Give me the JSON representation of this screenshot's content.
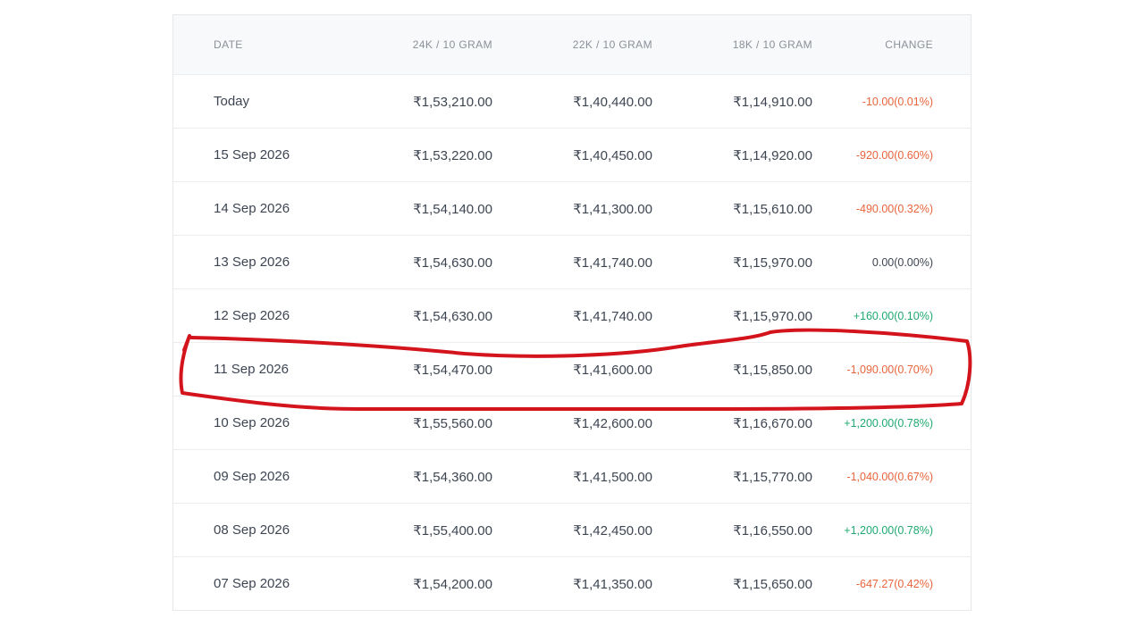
{
  "table": {
    "headers": {
      "date": "DATE",
      "k24": "24K / 10 GRAM",
      "k22": "22K / 10 GRAM",
      "k18": "18K / 10 GRAM",
      "change": "CHANGE"
    },
    "rows": [
      {
        "date": "Today",
        "k24": "₹1,53,210.00",
        "k22": "₹1,40,440.00",
        "k18": "₹1,14,910.00",
        "change": "-10.00(0.01%)",
        "trend": "neg"
      },
      {
        "date": "15 Sep 2026",
        "k24": "₹1,53,220.00",
        "k22": "₹1,40,450.00",
        "k18": "₹1,14,920.00",
        "change": "-920.00(0.60%)",
        "trend": "neg"
      },
      {
        "date": "14 Sep 2026",
        "k24": "₹1,54,140.00",
        "k22": "₹1,41,300.00",
        "k18": "₹1,15,610.00",
        "change": "-490.00(0.32%)",
        "trend": "neg"
      },
      {
        "date": "13 Sep 2026",
        "k24": "₹1,54,630.00",
        "k22": "₹1,41,740.00",
        "k18": "₹1,15,970.00",
        "change": "0.00(0.00%)",
        "trend": "flat"
      },
      {
        "date": "12 Sep 2026",
        "k24": "₹1,54,630.00",
        "k22": "₹1,41,740.00",
        "k18": "₹1,15,970.00",
        "change": "+160.00(0.10%)",
        "trend": "pos"
      },
      {
        "date": "11 Sep 2026",
        "k24": "₹1,54,470.00",
        "k22": "₹1,41,600.00",
        "k18": "₹1,15,850.00",
        "change": "-1,090.00(0.70%)",
        "trend": "neg"
      },
      {
        "date": "10 Sep 2026",
        "k24": "₹1,55,560.00",
        "k22": "₹1,42,600.00",
        "k18": "₹1,16,670.00",
        "change": "+1,200.00(0.78%)",
        "trend": "pos"
      },
      {
        "date": "09 Sep 2026",
        "k24": "₹1,54,360.00",
        "k22": "₹1,41,500.00",
        "k18": "₹1,15,770.00",
        "change": "-1,040.00(0.67%)",
        "trend": "neg"
      },
      {
        "date": "08 Sep 2026",
        "k24": "₹1,55,400.00",
        "k22": "₹1,42,450.00",
        "k18": "₹1,16,550.00",
        "change": "+1,200.00(0.78%)",
        "trend": "pos"
      },
      {
        "date": "07 Sep 2026",
        "k24": "₹1,54,200.00",
        "k22": "₹1,41,350.00",
        "k18": "₹1,15,650.00",
        "change": "-647.27(0.42%)",
        "trend": "neg"
      }
    ]
  },
  "colors": {
    "negative": "#e8643c",
    "positive": "#1fa971",
    "neutral": "#3d4552",
    "annotation": "#d4141c"
  }
}
